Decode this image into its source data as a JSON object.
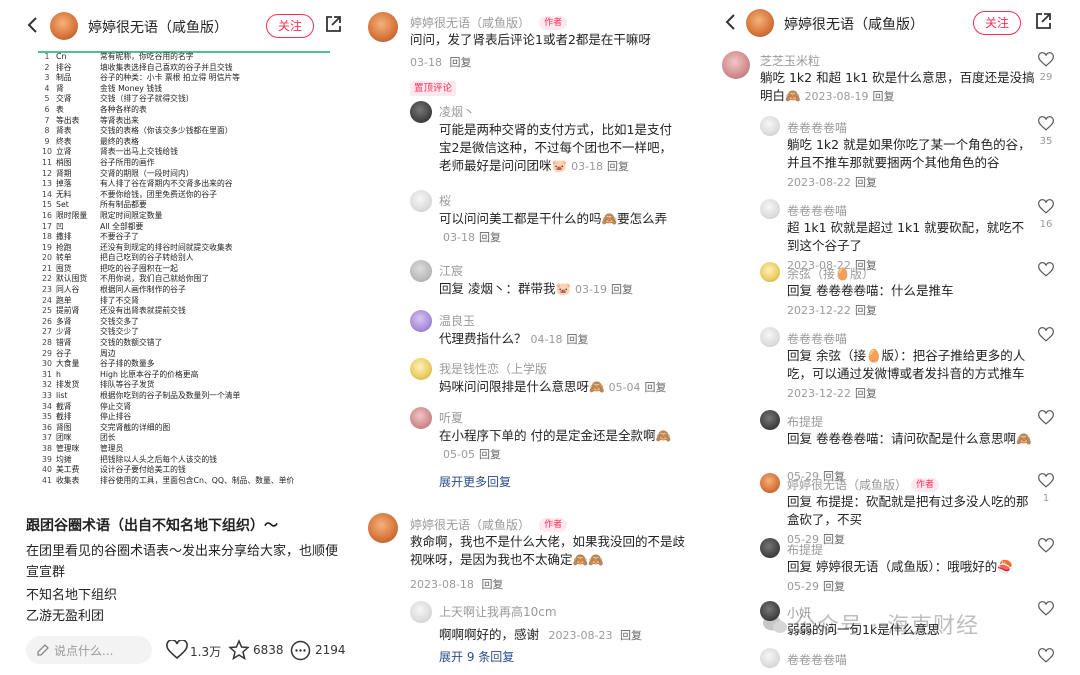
{
  "p1": {
    "username": "婷婷很无语（咸鱼版）",
    "follow": "关注",
    "table_rows": [
      {
        "n": "1",
        "t": "Cn",
        "d": "常有昵称，你吃谷用的名字"
      },
      {
        "n": "2",
        "t": "排谷",
        "d": "填收集表选择自己喜欢的谷子并且交钱"
      },
      {
        "n": "3",
        "t": "制品",
        "d": "谷子的种类：小卡 票根 拍立得 明信片等"
      },
      {
        "n": "4",
        "t": "肾",
        "d": "金钱 Money 钱钱"
      },
      {
        "n": "5",
        "t": "交肾",
        "d": "交钱（排了谷子就得交钱）"
      },
      {
        "n": "6",
        "t": "表",
        "d": "各种各样的表"
      },
      {
        "n": "7",
        "t": "等出表",
        "d": "等肾表出来"
      },
      {
        "n": "8",
        "t": "肾表",
        "d": "交钱的表格（你该交多少钱都在里面）"
      },
      {
        "n": "9",
        "t": "终表",
        "d": "最终的表格"
      },
      {
        "n": "10",
        "t": "立肾",
        "d": "肾表一出马上交钱给钱"
      },
      {
        "n": "11",
        "t": "梢图",
        "d": "谷子所用的画作"
      },
      {
        "n": "12",
        "t": "肾期",
        "d": "交肾的期限（一段时间内）"
      },
      {
        "n": "13",
        "t": "掉落",
        "d": "有人排了谷在肾期内不交肾多出来的谷"
      },
      {
        "n": "14",
        "t": "无料",
        "d": "不要你给钱，团里免费送你的谷子"
      },
      {
        "n": "15",
        "t": "Set",
        "d": "所有制品都要"
      },
      {
        "n": "16",
        "t": "限时限量",
        "d": "限定时间限定数量"
      },
      {
        "n": "17",
        "t": "凹",
        "d": "All 全部都要"
      },
      {
        "n": "18",
        "t": "撒排",
        "d": "不要谷子了"
      },
      {
        "n": "19",
        "t": "抢跑",
        "d": "还没有到规定的排谷时间就提交收集表"
      },
      {
        "n": "20",
        "t": "转单",
        "d": "把自己吃到的谷子转给别人"
      },
      {
        "n": "21",
        "t": "囤货",
        "d": "把吃的谷子囤积在一起"
      },
      {
        "n": "22",
        "t": "默认囤货",
        "d": "不用你说，我们自己就给你囤了"
      },
      {
        "n": "23",
        "t": "同人谷",
        "d": "根据同人画作制作的谷子"
      },
      {
        "n": "24",
        "t": "跑单",
        "d": "排了不交肾"
      },
      {
        "n": "25",
        "t": "提前肾",
        "d": "还没有出肾表就提前交钱"
      },
      {
        "n": "26",
        "t": "多肾",
        "d": "交钱交多了"
      },
      {
        "n": "27",
        "t": "少肾",
        "d": "交钱交少了"
      },
      {
        "n": "28",
        "t": "错肾",
        "d": "交钱的数额交错了"
      },
      {
        "n": "29",
        "t": "谷子",
        "d": "周边"
      },
      {
        "n": "30",
        "t": "大食量",
        "d": "谷子排的数量多"
      },
      {
        "n": "31",
        "t": "h",
        "d": "High 比原本谷子的价格更高"
      },
      {
        "n": "32",
        "t": "排发货",
        "d": "排队等谷子发货"
      },
      {
        "n": "33",
        "t": "list",
        "d": "根据你吃到的谷子制品及数量列一个清单"
      },
      {
        "n": "34",
        "t": "截肾",
        "d": "停止交肾"
      },
      {
        "n": "35",
        "t": "截排",
        "d": "停止排谷"
      },
      {
        "n": "36",
        "t": "肾图",
        "d": "交完肾截的详细的图"
      },
      {
        "n": "37",
        "t": "团咪",
        "d": "团长"
      },
      {
        "n": "38",
        "t": "管理咪",
        "d": "管理员"
      },
      {
        "n": "39",
        "t": "均摊",
        "d": "把钱除以人头之后每个人该交的钱"
      },
      {
        "n": "40",
        "t": "美工费",
        "d": "设计谷子要付给美工的钱"
      },
      {
        "n": "41",
        "t": "收集表",
        "d": "排谷使用的工具，里面包含Cn、QQ、制品、数量、单价"
      }
    ],
    "title": "跟团谷圈术语（出自不知名地下组织）～",
    "desc1": "在团里看见的谷圈术语表～发出来分享给大家，也顺便宣宣群",
    "desc2": "不知名地下组织",
    "desc3": "乙游无盈利团",
    "comment_placeholder": "说点什么...",
    "likes": "1.3万",
    "stars": "6838",
    "comments": "2194"
  },
  "p2": {
    "main": {
      "name": "婷婷很无语（咸鱼版）",
      "tag": "作者",
      "text": "问问，发了肾表后评论1或者2都是在干嘛呀",
      "time": "03-18",
      "reply": "回复"
    },
    "pinned": "置顶评论",
    "replies": [
      {
        "name": "凌烟丶",
        "text": "可能是两种交肾的支付方式，比如1是支付宝2是微信这种，不过每个团也不一样吧，老师最好是问问团咪🐷",
        "time": "03-18",
        "reply": "回复"
      },
      {
        "name": "桜",
        "text": "可以问问美工都是干什么的吗🙈要怎么弄",
        "time": "03-18",
        "reply": "回复"
      },
      {
        "name": "江宸",
        "text": "回复 凌烟丶：群带我🐷",
        "time": "03-19",
        "reply": "回复"
      },
      {
        "name": "温良玉",
        "text": "代理费指什么？",
        "time": "04-18",
        "reply": "回复"
      },
      {
        "name": "我是钱性恋（上学版",
        "text": "妈咪问问限排是什么意思呀🙈",
        "time": "05-04",
        "reply": "回复"
      },
      {
        "name": "听夏",
        "text": "在小程序下单的 付的是定金还是全款啊🙈",
        "time": "05-05",
        "reply": "回复"
      }
    ],
    "expand_more": "展开更多回复",
    "main2": {
      "name": "婷婷很无语（咸鱼版）",
      "tag": "作者",
      "text": "救命啊，我也不是什么大佬，如果我没回的不是歧视咪呀，是因为我也不太确定🙈🙈",
      "time": "2023-08-18",
      "reply": "回复"
    },
    "reply2": {
      "name": "上天啊让我再高10cm",
      "text": "啊啊啊好的，感谢",
      "time": "2023-08-23",
      "reply": "回复"
    },
    "expand_n": "展开 9 条回复"
  },
  "p3": {
    "username": "婷婷很无语（咸鱼版）",
    "follow": "关注",
    "main": {
      "name": "芝芝玉米粒",
      "text": "躺吃 1k2 和超 1k1 砍是什么意思，百度还是没搞明白🙈",
      "time": "2023-08-19",
      "reply": "回复",
      "likes": "29"
    },
    "replies": [
      {
        "name": "卷卷卷卷喵",
        "text": "躺吃 1k2 就是如果你吃了某一个角色的谷，并且不推车那就要捆两个其他角色的谷",
        "time": "2023-08-22",
        "reply": "回复",
        "likes": "35"
      },
      {
        "name": "卷卷卷卷喵",
        "text": "超 1k1 砍就是超过 1k1 就要砍配，就吃不到这个谷子了",
        "time": "2023-08-22",
        "reply": "回复",
        "likes": "16"
      },
      {
        "name": "余弦（接🥚版）",
        "text": "回复 卷卷卷卷喵：什么是推车",
        "time": "2023-12-22",
        "reply": "回复",
        "likes": ""
      },
      {
        "name": "卷卷卷卷喵",
        "text": "回复 余弦（接🥚版）：把谷子推给更多的人吃，可以通过发微博或者发抖音的方式推车",
        "time": "2023-12-22",
        "reply": "回复",
        "likes": ""
      },
      {
        "name": "布提提",
        "text": "回复 卷卷卷卷喵：请问砍配是什么意思啊🙈",
        "time": "05-29",
        "reply": "回复",
        "likes": ""
      },
      {
        "name": "婷婷很无语（咸鱼版）",
        "tag": "作者",
        "text": "回复 布提提：砍配就是把有过多没人吃的那盒砍了，不买",
        "time": "05-29",
        "reply": "回复",
        "likes": "1"
      },
      {
        "name": "布提提",
        "text": "回复 婷婷很无语（咸鱼版）：哦哦好的🍣",
        "time": "05-29",
        "reply": "回复",
        "likes": ""
      },
      {
        "name": "小妍",
        "text": "弱弱的问一句1k是什么意思",
        "time": "",
        "reply": "",
        "likes": ""
      },
      {
        "name": "卷卷卷卷喵",
        "text": "",
        "time": "",
        "reply": "",
        "likes": ""
      }
    ],
    "watermark": "公众号 · 海克财经"
  }
}
